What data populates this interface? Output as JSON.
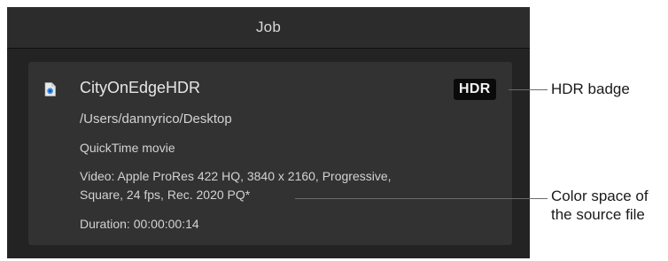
{
  "header": {
    "title": "Job"
  },
  "job": {
    "file_name": "CityOnEdgeHDR",
    "hdr_badge": "HDR",
    "path": "/Users/dannyrico/Desktop",
    "format": "QuickTime movie",
    "video_line1": "Video: Apple ProRes 422 HQ, 3840 x 2160, Progressive,",
    "video_line2": "Square, 24 fps, Rec. 2020 PQ*",
    "duration": "Duration: 00:00:00:14"
  },
  "callouts": {
    "hdr_badge": "HDR badge",
    "color_space_line1": "Color space of",
    "color_space_line2": "the source file"
  },
  "icons": {
    "file": "quicktime-file-icon"
  },
  "colors": {
    "window_bg": "#232323",
    "header_bg": "#2c2c2c",
    "card_bg": "#323232",
    "badge_bg": "#0a0a0a",
    "icon_accent": "#3b8ee8"
  }
}
